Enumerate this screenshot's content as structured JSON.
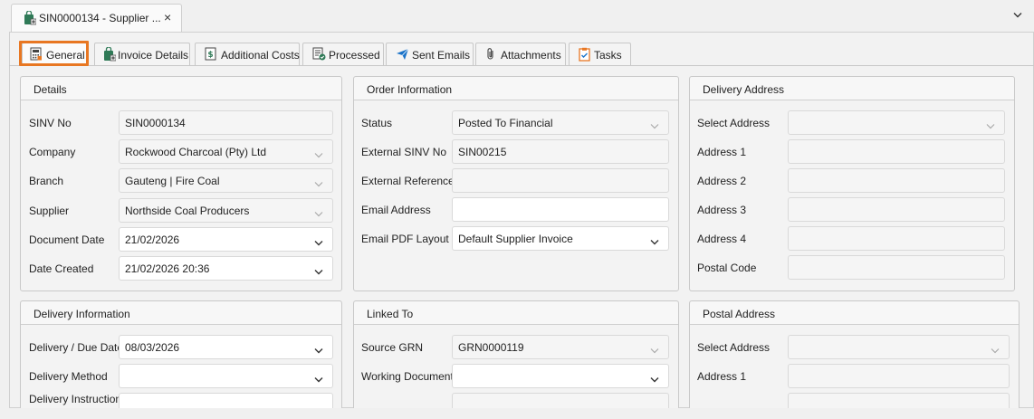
{
  "document_tab": {
    "title": "SIN0000134 - Supplier ...",
    "close": "×"
  },
  "section_tabs": [
    {
      "label": "General",
      "icon": "calculator-icon"
    },
    {
      "label": "Invoice Details",
      "icon": "invoice-bag-icon"
    },
    {
      "label": "Additional Costs",
      "icon": "dollar-document-icon"
    },
    {
      "label": "Processed",
      "icon": "processed-document-icon"
    },
    {
      "label": "Sent Emails",
      "icon": "paper-plane-icon"
    },
    {
      "label": "Attachments",
      "icon": "paperclip-icon"
    },
    {
      "label": "Tasks",
      "icon": "clipboard-check-icon"
    }
  ],
  "details": {
    "header": "Details",
    "fields": [
      {
        "label": "SINV No",
        "value": "SIN0000134"
      },
      {
        "label": "Company",
        "value": "Rockwood Charcoal (Pty) Ltd"
      },
      {
        "label": "Branch",
        "value": "Gauteng | Fire Coal"
      },
      {
        "label": "Supplier",
        "value": "Northside Coal Producers"
      },
      {
        "label": "Document Date",
        "value": "21/02/2026"
      },
      {
        "label": "Date Created",
        "value": "21/02/2026 20:36"
      }
    ]
  },
  "order_information": {
    "header": "Order Information",
    "fields": [
      {
        "label": "Status",
        "value": "Posted To Financial"
      },
      {
        "label": "External SINV No",
        "value": "SIN00215"
      },
      {
        "label": "External Reference",
        "value": ""
      },
      {
        "label": "Email Address",
        "value": ""
      },
      {
        "label": "Email PDF Layout",
        "value": "Default Supplier Invoice"
      }
    ]
  },
  "delivery_address": {
    "header": "Delivery Address",
    "fields": [
      {
        "label": "Select Address",
        "value": ""
      },
      {
        "label": "Address 1",
        "value": ""
      },
      {
        "label": "Address 2",
        "value": ""
      },
      {
        "label": "Address 3",
        "value": ""
      },
      {
        "label": "Address 4",
        "value": ""
      },
      {
        "label": "Postal Code",
        "value": ""
      }
    ]
  },
  "delivery_information": {
    "header": "Delivery Information",
    "fields": [
      {
        "label": "Delivery / Due Date",
        "value": "08/03/2026"
      },
      {
        "label": "Delivery Method",
        "value": ""
      },
      {
        "label": "Delivery Instruction",
        "value": ""
      }
    ]
  },
  "linked_to": {
    "header": "Linked To",
    "fields": [
      {
        "label": "Source GRN",
        "value": "GRN0000119"
      },
      {
        "label": "Working Document",
        "value": ""
      }
    ]
  },
  "postal_address": {
    "header": "Postal Address",
    "fields": [
      {
        "label": "Select Address",
        "value": ""
      },
      {
        "label": "Address 1",
        "value": ""
      }
    ]
  },
  "colors": {
    "focus_outline": "#e87722",
    "accent_blue": "#1a73c9",
    "green_icon": "#3a8a5a"
  }
}
